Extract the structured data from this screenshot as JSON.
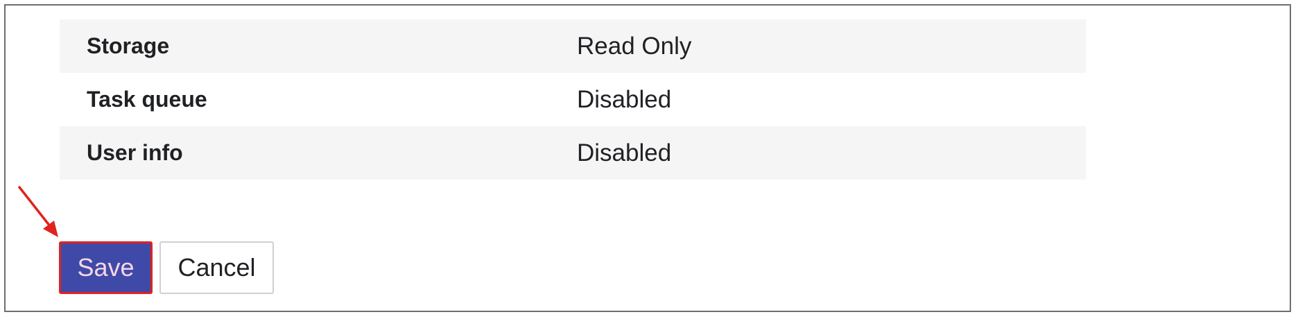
{
  "settings": {
    "rows": [
      {
        "label": "Storage",
        "value": "Read Only"
      },
      {
        "label": "Task queue",
        "value": "Disabled"
      },
      {
        "label": "User info",
        "value": "Disabled"
      }
    ]
  },
  "actions": {
    "save_label": "Save",
    "cancel_label": "Cancel"
  },
  "annotation": {
    "icon": "arrow-icon",
    "color": "#e0231d"
  },
  "colors": {
    "save_background": "#3f4aa8",
    "save_text": "#f6d6e6",
    "row_shade": "#f5f5f5",
    "highlight": "#e0231d"
  }
}
